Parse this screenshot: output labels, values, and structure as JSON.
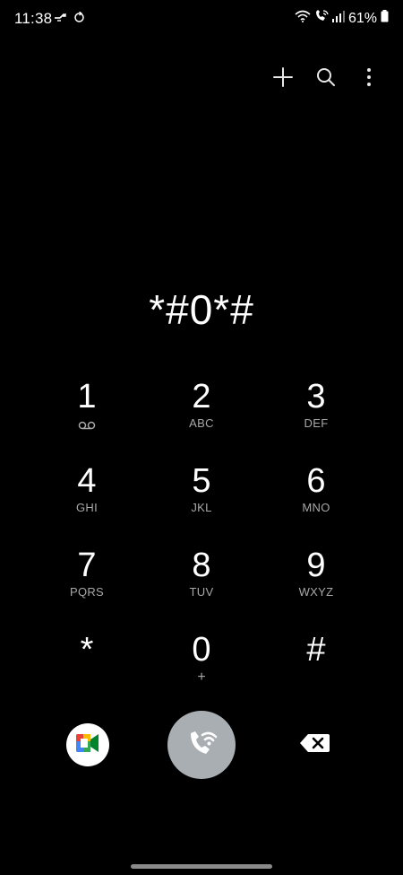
{
  "status_bar": {
    "time": "11:38",
    "battery_percent": "61%",
    "icons": [
      "missed-call-icon",
      "sync-icon",
      "wifi-icon",
      "wifi-calling-icon",
      "signal-icon",
      "battery-icon"
    ]
  },
  "top_actions": [
    "add-icon",
    "search-icon",
    "more-options-icon"
  ],
  "dialer": {
    "number": "*#0*#"
  },
  "keypad": {
    "keys": [
      {
        "digit": "1",
        "letters": "",
        "sub_icon": "voicemail-icon"
      },
      {
        "digit": "2",
        "letters": "ABC"
      },
      {
        "digit": "3",
        "letters": "DEF"
      },
      {
        "digit": "4",
        "letters": "GHI"
      },
      {
        "digit": "5",
        "letters": "JKL"
      },
      {
        "digit": "6",
        "letters": "MNO"
      },
      {
        "digit": "7",
        "letters": "PQRS"
      },
      {
        "digit": "8",
        "letters": "TUV"
      },
      {
        "digit": "9",
        "letters": "WXYZ"
      },
      {
        "digit": "*",
        "letters": ""
      },
      {
        "digit": "0",
        "letters": "+"
      },
      {
        "digit": "#",
        "letters": ""
      }
    ]
  },
  "bottom_actions": {
    "video_call_icon": "google-meet-icon",
    "call_icon": "wifi-call-icon",
    "delete_icon": "backspace-icon"
  },
  "colors": {
    "background": "#000000",
    "text_primary": "#ffffff",
    "text_secondary": "#a8a8a8",
    "call_button": "#a9aeb2"
  }
}
